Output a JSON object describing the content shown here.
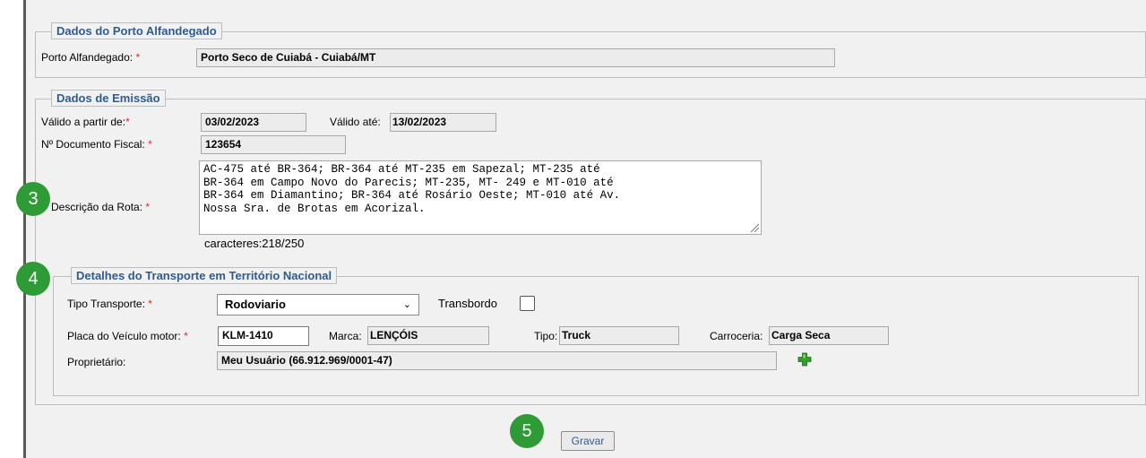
{
  "porto": {
    "legend": "Dados do Porto Alfandegado",
    "label": "Porto Alfandegado:",
    "required_mark": "*",
    "value": "Porto Seco de Cuiabá - Cuiabá/MT"
  },
  "emissao": {
    "legend": "Dados de Emissão",
    "valido_de_label": "Válido a partir de:",
    "valido_de_value": "03/02/2023",
    "valido_ate_label": "Válido até:",
    "valido_ate_value": "13/02/2023",
    "doc_label": "Nº Documento Fiscal:",
    "doc_value": "123654",
    "rota_label": "Descrição da Rota:",
    "rota_value": "AC-475 até BR-364; BR-364 até MT-235 em Sapezal; MT-235 até\nBR-364 em Campo Novo do Parecis; MT-235, MT- 249 e MT-010 até\nBR-364 em Diamantino; BR-364 até Rosário Oeste; MT-010 até Av.\nNossa Sra. de Brotas em Acorizal.",
    "counter": "caracteres:218/250",
    "required_mark": "*"
  },
  "transporte": {
    "legend": "Detalhes do Transporte em Território Nacional",
    "tipo_label": "Tipo Transporte:",
    "tipo_value": "Rodoviario",
    "transbordo_label": "Transbordo",
    "transbordo_checked": false,
    "placa_label": "Placa do Veículo motor:",
    "placa_value": "KLM-1410",
    "marca_label": "Marca:",
    "marca_value": "LENÇÓIS",
    "tipo2_label": "Tipo:",
    "tipo2_value": "Truck",
    "carroceria_label": "Carroceria:",
    "carroceria_value": "Carga Seca",
    "proprietario_label": "Proprietário:",
    "proprietario_value": "Meu Usuário (66.912.969/0001-47)",
    "required_mark": "*",
    "add_icon": "green-plus-icon"
  },
  "actions": {
    "save_label": "Gravar"
  },
  "badges": {
    "step3": "3",
    "step4": "4",
    "step5": "5"
  },
  "colors": {
    "legend": "#2f5b8e",
    "required": "#d03030",
    "badge": "#2e9b37",
    "plus": "#33a02c"
  }
}
